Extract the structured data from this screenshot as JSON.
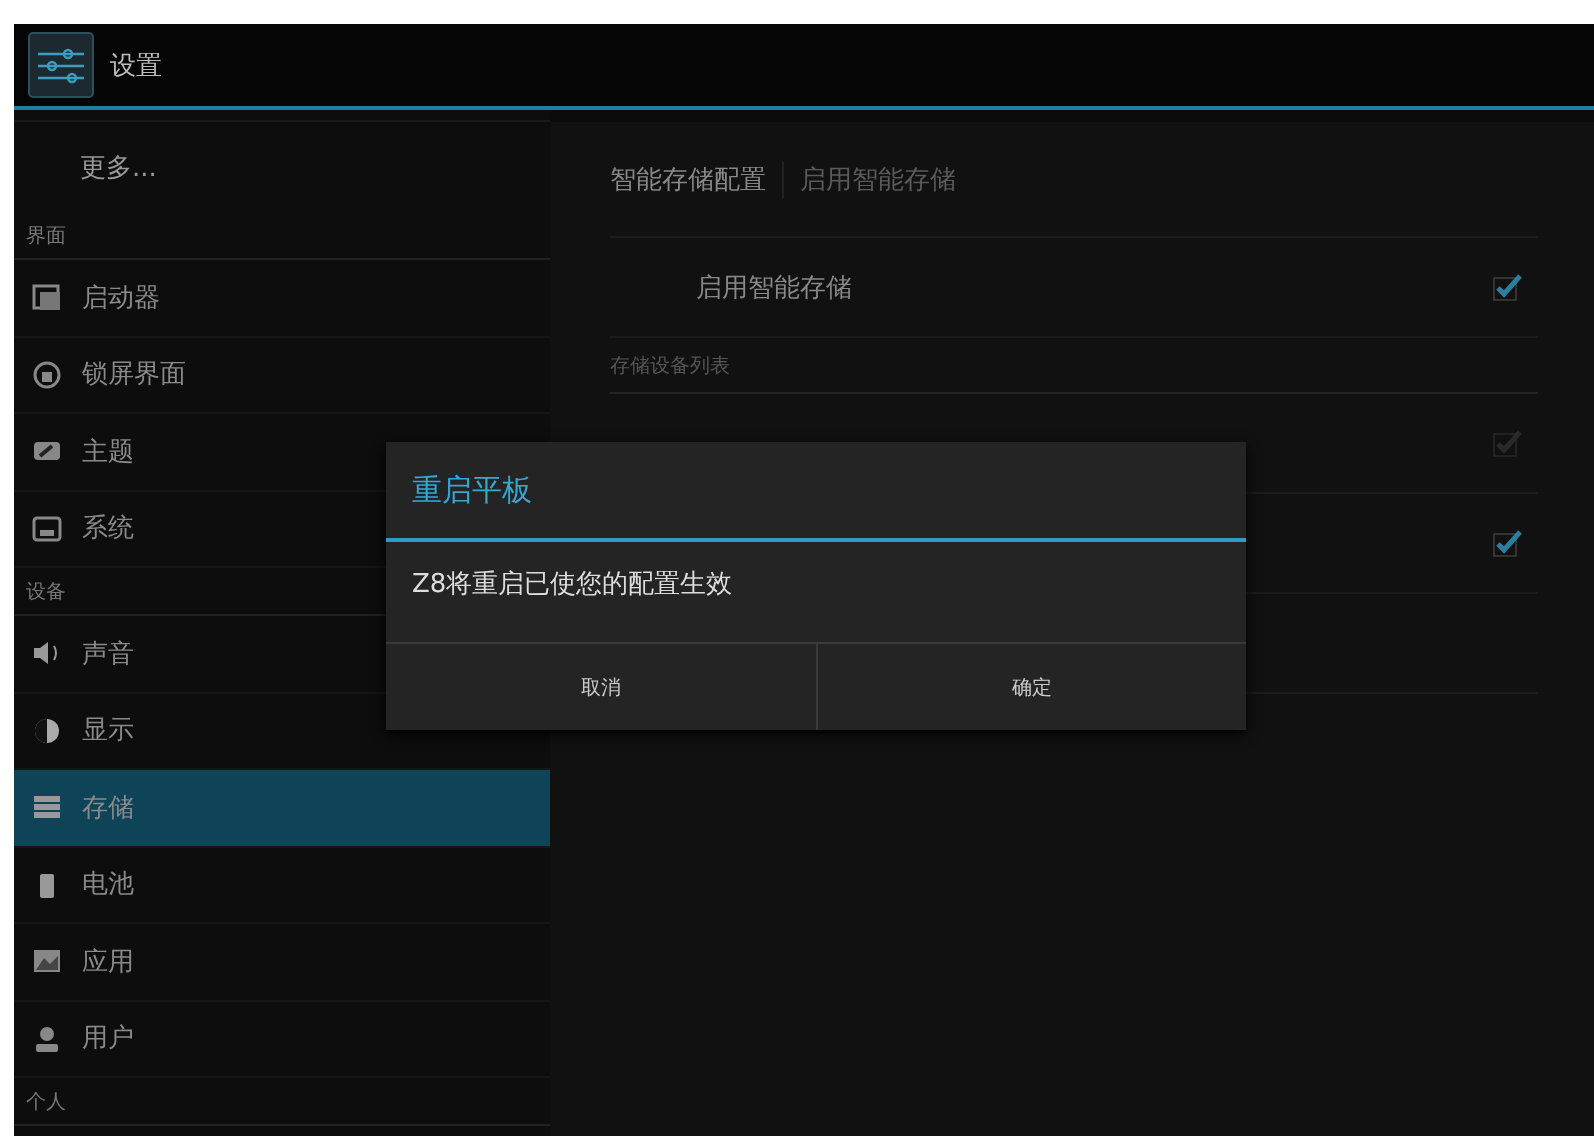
{
  "action_bar": {
    "title": "设置"
  },
  "sidebar": {
    "items": [
      {
        "kind": "more",
        "label": "更多...",
        "selected": false
      },
      {
        "kind": "header",
        "label": "界面"
      },
      {
        "kind": "item",
        "label": "启动器",
        "selected": false
      },
      {
        "kind": "item",
        "label": "锁屏界面",
        "selected": false
      },
      {
        "kind": "item",
        "label": "主题",
        "selected": false
      },
      {
        "kind": "item",
        "label": "系统",
        "selected": false
      },
      {
        "kind": "header",
        "label": "设备"
      },
      {
        "kind": "item",
        "label": "声音",
        "selected": false
      },
      {
        "kind": "item",
        "label": "显示",
        "selected": false
      },
      {
        "kind": "item",
        "label": "存储",
        "selected": true
      },
      {
        "kind": "item",
        "label": "电池",
        "selected": false
      },
      {
        "kind": "item",
        "label": "应用",
        "selected": false
      },
      {
        "kind": "item",
        "label": "用户",
        "selected": false
      },
      {
        "kind": "header",
        "label": "个人"
      }
    ]
  },
  "panel": {
    "breadcrumb": [
      "智能存储配置",
      "启用智能存储"
    ],
    "rows": [
      {
        "kind": "checkbox",
        "label": "启用智能存储",
        "checked": true,
        "disabled": false
      },
      {
        "kind": "header",
        "label": "存储设备列表"
      },
      {
        "kind": "checkbox",
        "checked": true,
        "disabled": true
      },
      {
        "kind": "checkbox",
        "checked": true,
        "disabled": false
      },
      {
        "kind": "blank"
      }
    ]
  },
  "dialog": {
    "title": "重启平板",
    "message": "Z8将重启已使您的配置生效",
    "buttons": [
      "取消",
      "确定"
    ]
  }
}
